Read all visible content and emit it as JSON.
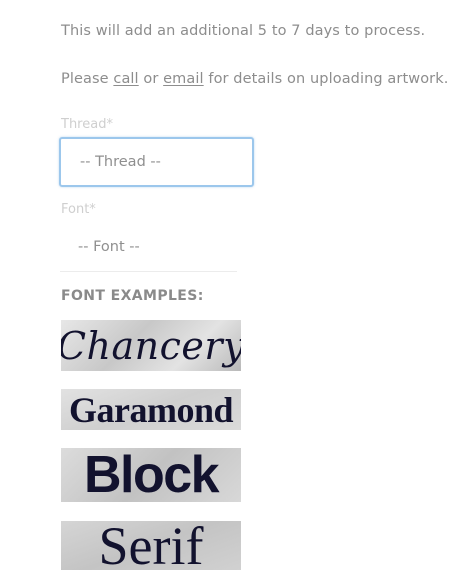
{
  "notes": {
    "processing": "This will add an additional 5 to 7 days to process.",
    "contact_prefix": "Please ",
    "call_link": "call",
    "contact_middle": " or ",
    "email_link": "email",
    "contact_suffix": " for details on uploading artwork."
  },
  "thread_field": {
    "label": "Thread*",
    "selected": "-- Thread --"
  },
  "font_field": {
    "label": "Font*",
    "selected": "-- Font --"
  },
  "font_examples": {
    "title": "FONT EXAMPLES:",
    "items": [
      {
        "name": "Chancery"
      },
      {
        "name": "Garamond"
      },
      {
        "name": "Block"
      },
      {
        "name": "Serif"
      }
    ]
  }
}
